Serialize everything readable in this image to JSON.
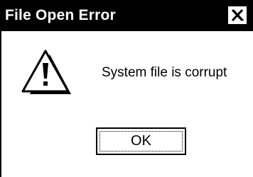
{
  "window": {
    "title": "File Open Error",
    "close_icon": "close-x-icon"
  },
  "content": {
    "icon": "warning-triangle-icon",
    "message": "System file is corrupt"
  },
  "buttons": {
    "ok_label": "OK"
  },
  "colors": {
    "titlebar": "#000000",
    "title_text": "#ffffff",
    "background": "#ffffff"
  }
}
